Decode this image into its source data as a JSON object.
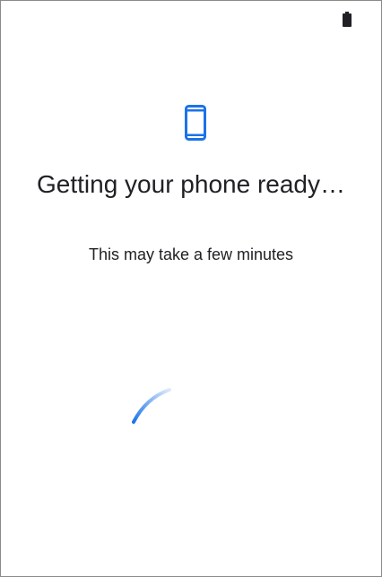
{
  "status_bar": {
    "battery_icon": "battery-full-icon"
  },
  "setup": {
    "icon": "smartphone-icon",
    "title": "Getting your phone ready…",
    "subtitle": "This may take a few minutes",
    "progress_indicator": "indeterminate"
  },
  "colors": {
    "accent": "#1a73e8",
    "text": "#202124",
    "background": "#ffffff"
  }
}
